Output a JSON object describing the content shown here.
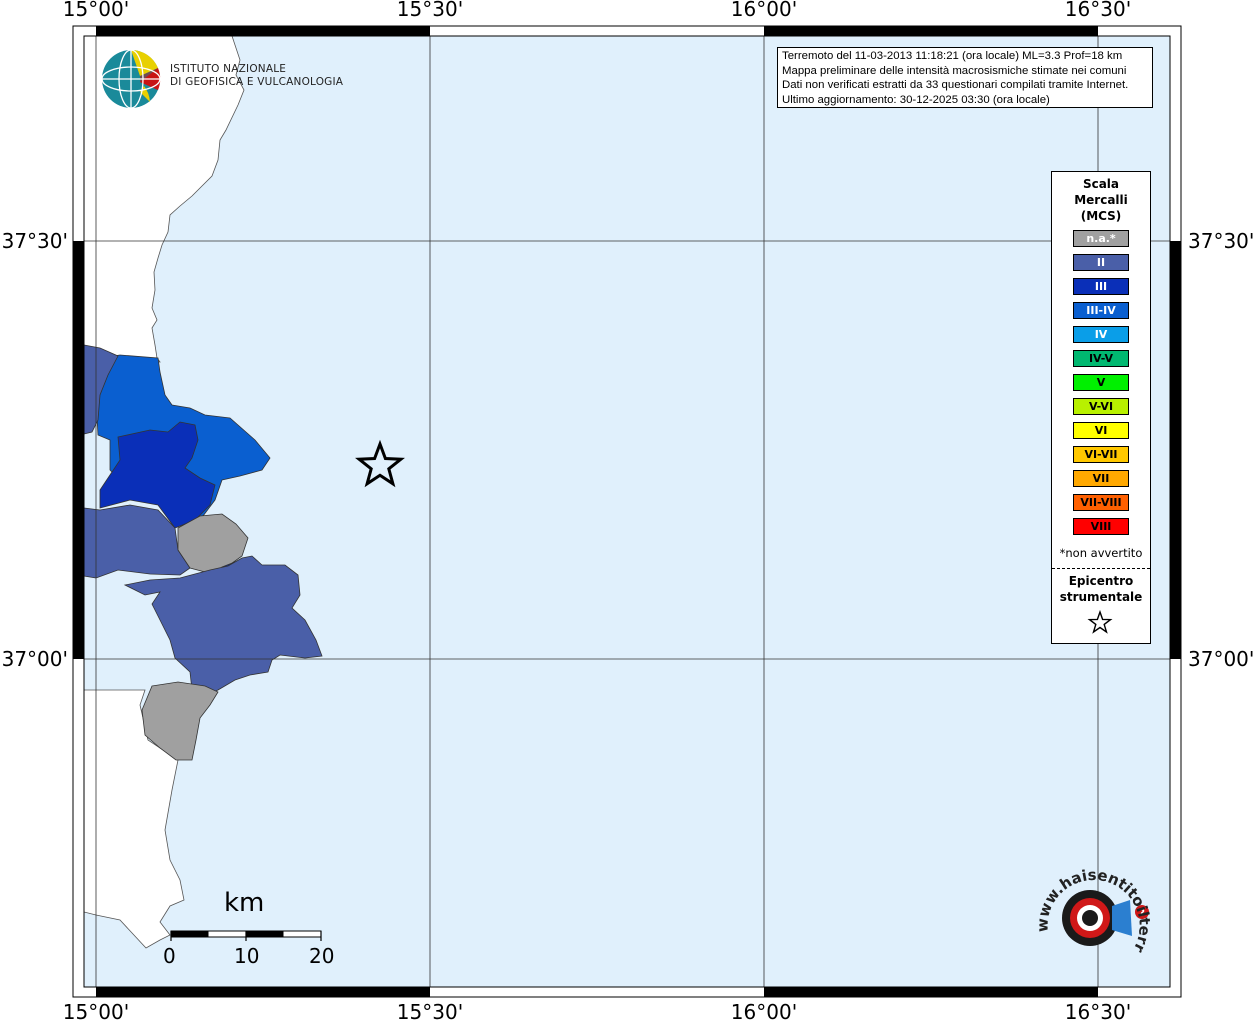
{
  "axes": {
    "top_labels": [
      "15°00'",
      "15°30'",
      "16°00'",
      "16°30'"
    ],
    "bottom_labels": [
      "15°00'",
      "15°30'",
      "16°00'",
      "16°30'"
    ],
    "left_labels": [
      "37°30'",
      "37°00'"
    ],
    "right_labels": [
      "37°30'",
      "37°00'"
    ]
  },
  "info": {
    "line1": "Terremoto del 11-03-2013 11:18:21 (ora locale) ML=3.3 Prof=18 km",
    "line2": "Mappa preliminare delle intensità macrosismiche stimate nei comuni",
    "line3": "Dati non verificati estratti da 33 questionari compilati tramite Internet.",
    "line4": "Ultimo aggiornamento: 30-12-2025 03:30 (ora locale)"
  },
  "ingv": {
    "line1": "ISTITUTO NAZIONALE",
    "line2": "DI GEOFISICA E VULCANOLOGIA"
  },
  "legend": {
    "title_line1": "Scala",
    "title_line2": "Mercalli",
    "title_line3": "(MCS)",
    "classes": [
      {
        "label": "n.a.*",
        "color": "#a0a0a0",
        "text_color": "#ffffff"
      },
      {
        "label": "II",
        "color": "#4a5fa8",
        "text_color": "#ffffff"
      },
      {
        "label": "III",
        "color": "#0a2fb8",
        "text_color": "#ffffff"
      },
      {
        "label": "III-IV",
        "color": "#0a5fd0",
        "text_color": "#ffffff"
      },
      {
        "label": "IV",
        "color": "#0a9ee8",
        "text_color": "#ffffff"
      },
      {
        "label": "IV-V",
        "color": "#00b870",
        "text_color": "#000000"
      },
      {
        "label": "V",
        "color": "#00f000",
        "text_color": "#000000"
      },
      {
        "label": "V-VI",
        "color": "#b8f000",
        "text_color": "#000000"
      },
      {
        "label": "VI",
        "color": "#ffff00",
        "text_color": "#000000"
      },
      {
        "label": "VI-VII",
        "color": "#ffc800",
        "text_color": "#000000"
      },
      {
        "label": "VII",
        "color": "#ffa800",
        "text_color": "#000000"
      },
      {
        "label": "VII-VIII",
        "color": "#ff6000",
        "text_color": "#000000"
      },
      {
        "label": "VIII",
        "color": "#ff0000",
        "text_color": "#000000"
      }
    ],
    "na_note": "*non avvertito",
    "epicentre_line1": "Epicentro",
    "epicentre_line2": "strumentale"
  },
  "colors": {
    "sea": "#e0f0fc",
    "land": "#ffffff",
    "na": "#a0a0a0",
    "ii": "#4a5fa8",
    "iii": "#0a2fb8",
    "iii_iv": "#0a5fd0"
  },
  "scalebar": {
    "unit": "km",
    "ticks": [
      "0",
      "10",
      "20"
    ]
  },
  "hst_logo": {
    "text": "www.haisentitoilterremoto.it"
  }
}
